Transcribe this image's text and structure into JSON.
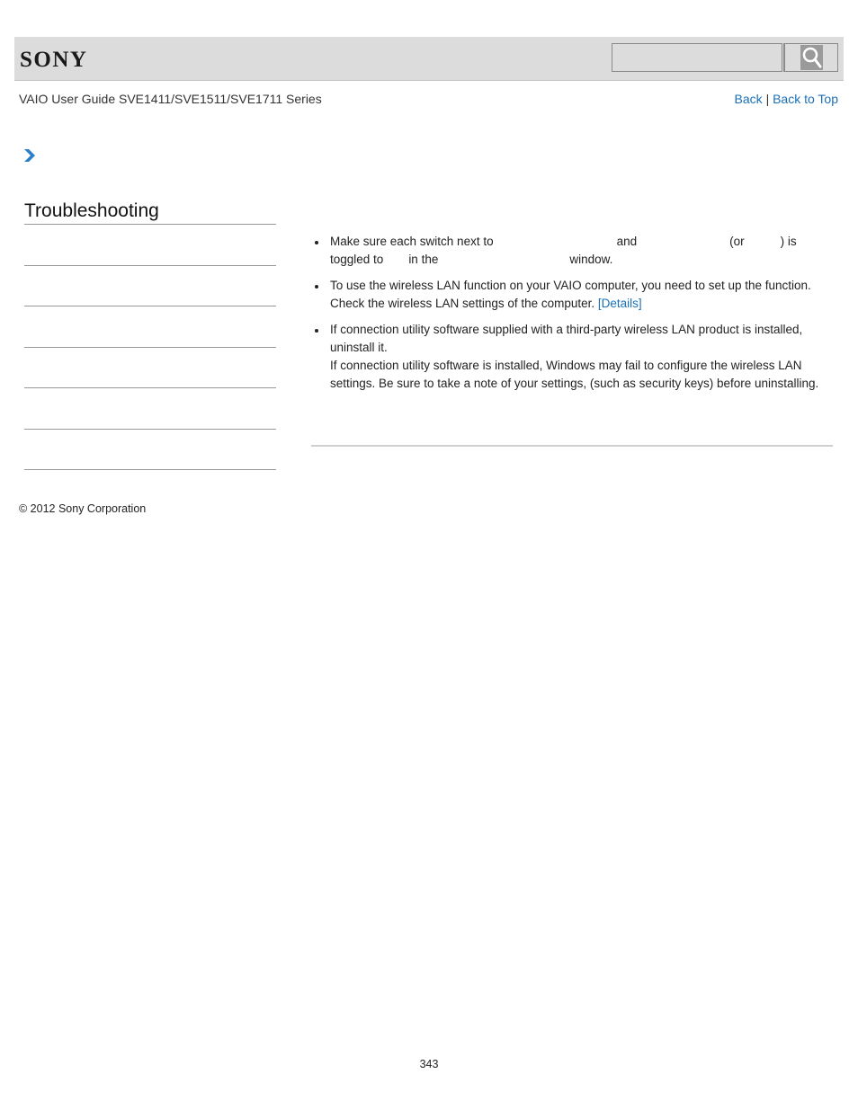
{
  "header": {
    "logo": "SONY",
    "search": {
      "value": "",
      "placeholder": ""
    },
    "search_icon": "search-icon"
  },
  "subheader": {
    "guide_title": "VAIO User Guide SVE1411/SVE1511/SVE1711 Series",
    "back_label": "Back",
    "separator": "|",
    "back_to_top_label": "Back to Top"
  },
  "breadcrumb": {
    "icon": "chevron-right-icon"
  },
  "sidebar": {
    "title": "Troubleshooting",
    "items": [
      "",
      "",
      "",
      "",
      "",
      ""
    ]
  },
  "main": {
    "bullets": [
      {
        "segments": [
          "Make sure each switch next to",
          "and",
          "(or",
          ") is",
          "toggled to",
          "in the",
          "window."
        ]
      },
      {
        "line1": "To use the wireless LAN function on your VAIO computer, you need to set up the function.",
        "line2": "Check the wireless LAN settings of the computer.",
        "link": "[Details]"
      },
      {
        "line1": "If connection utility software supplied with a third-party wireless LAN product is installed, uninstall it.",
        "line2": "If connection utility software is installed, Windows may fail to configure the wireless LAN settings. Be sure to take a note of your settings, (such as security keys) before uninstalling."
      }
    ]
  },
  "footer": {
    "copyright": "© 2012 Sony Corporation",
    "page_number": "343"
  },
  "colors": {
    "link": "#1a70b8",
    "header_bg": "#dcdcdc",
    "chevron": "#2a7fc8"
  }
}
